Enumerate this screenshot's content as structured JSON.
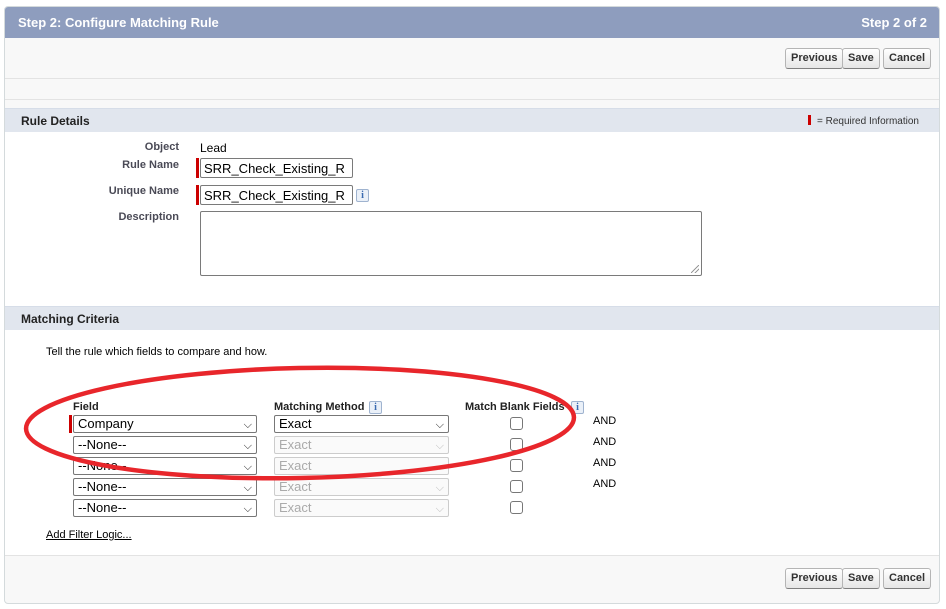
{
  "header": {
    "title": "Step 2: Configure Matching Rule",
    "step": "Step 2 of 2"
  },
  "buttons": {
    "previous": "Previous",
    "save": "Save",
    "cancel": "Cancel"
  },
  "rule_details": {
    "heading": "Rule Details",
    "required_legend": "= Required Information",
    "object_label": "Object",
    "object_value": "Lead",
    "rule_name_label": "Rule Name",
    "rule_name_value": "SRR_Check_Existing_R",
    "unique_name_label": "Unique Name",
    "unique_name_value": "SRR_Check_Existing_R",
    "description_label": "Description",
    "info_glyph": "i"
  },
  "matching_criteria": {
    "heading": "Matching Criteria",
    "instructions": "Tell the rule which fields to compare and how.",
    "columns": {
      "field": "Field",
      "method": "Matching Method",
      "blank": "Match Blank Fields"
    },
    "rows": [
      {
        "field": "Company",
        "method": "Exact",
        "method_disabled": false,
        "connector": "AND"
      },
      {
        "field": "--None--",
        "method": "Exact",
        "method_disabled": true,
        "connector": "AND"
      },
      {
        "field": "--None--",
        "method": "Exact",
        "method_disabled": true,
        "connector": "AND"
      },
      {
        "field": "--None--",
        "method": "Exact",
        "method_disabled": true,
        "connector": "AND"
      },
      {
        "field": "--None--",
        "method": "Exact",
        "method_disabled": true,
        "connector": ""
      }
    ],
    "add_filter_logic": "Add Filter Logic..."
  },
  "icons": {
    "dropdown": "chevron-down-icon",
    "info": "info-icon"
  },
  "colors": {
    "title_bar": "#8e9dbe",
    "section_header": "#e1e6ee",
    "required": "#cc0000",
    "annotation": "#e8262b"
  }
}
